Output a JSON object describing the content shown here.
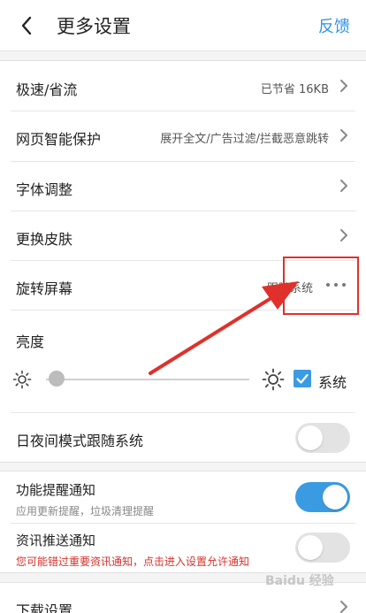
{
  "header": {
    "title": "更多设置",
    "feedback": "反馈"
  },
  "rows": {
    "speed": {
      "label": "极速/省流",
      "value": "已节省 16KB"
    },
    "smart": {
      "label": "网页智能保护",
      "value": "展开全文/广告过滤/拦截恶意跳转"
    },
    "font": {
      "label": "字体调整"
    },
    "skin": {
      "label": "更换皮肤"
    },
    "rotate": {
      "label": "旋转屏幕",
      "value": "跟随系统"
    },
    "brightness": {
      "label": "亮度",
      "system_label": "系统",
      "system_checked": true
    },
    "daynight": {
      "label": "日夜间模式跟随系统",
      "on": false
    },
    "feature": {
      "label": "功能提醒通知",
      "sub": "应用更新提醒，垃圾清理提醒",
      "on": true
    },
    "news": {
      "label": "资讯推送通知",
      "sub": "您可能错过重要资讯通知，点击进入设置允许通知",
      "on": false
    },
    "download": {
      "label": "下载设置"
    }
  },
  "colors": {
    "accent": "#3b9be2",
    "link": "#2f93e6",
    "warning": "#d9312b",
    "annotation": "#e0302b"
  },
  "icons": [
    "back-arrow-icon",
    "chevron-right-icon",
    "more-dots-icon",
    "sun-low-icon",
    "sun-high-icon",
    "checkmark-icon"
  ]
}
